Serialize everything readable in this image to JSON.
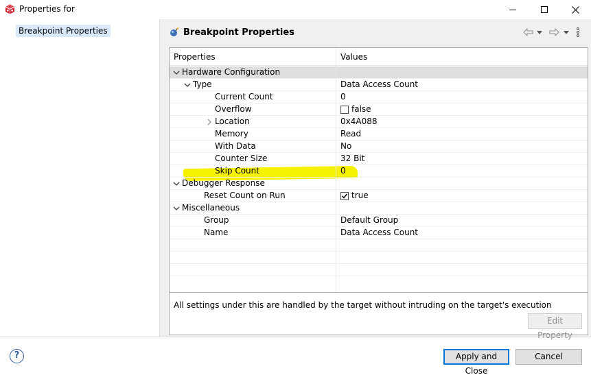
{
  "window": {
    "title": "Properties for",
    "app_icon": "cube-logo-icon",
    "controls": [
      "minimize-icon",
      "maximize-icon",
      "close-icon"
    ]
  },
  "sidebar": {
    "items": [
      {
        "label": "Breakpoint Properties",
        "selected": true
      }
    ]
  },
  "panel": {
    "title": "Breakpoint Properties",
    "title_icon": "breakpoint-properties-icon",
    "nav_icons": [
      "back-arrow-icon",
      "dropdown-icon",
      "forward-arrow-icon",
      "dropdown-icon",
      "view-menu-icon"
    ]
  },
  "table": {
    "columns": [
      "Properties",
      "Values"
    ],
    "rows": [
      {
        "label": "Hardware Configuration",
        "value": "",
        "indent": 0,
        "chevron": "down",
        "selected": true
      },
      {
        "label": "Type",
        "value": "Data Access Count",
        "indent": 1,
        "chevron": "down"
      },
      {
        "label": "Current Count",
        "value": "0",
        "indent": 3
      },
      {
        "label": "Overflow",
        "value": "false",
        "indent": 3,
        "checkbox": false
      },
      {
        "label": "Location",
        "value": "0x4A088",
        "indent": 3,
        "chevron": "right"
      },
      {
        "label": "Memory",
        "value": "Read",
        "indent": 3
      },
      {
        "label": "With Data",
        "value": "No",
        "indent": 3
      },
      {
        "label": "Counter Size",
        "value": "32 Bit",
        "indent": 3
      },
      {
        "label": "Skip Count",
        "value": "0",
        "indent": 3
      },
      {
        "label": "Debugger Response",
        "value": "",
        "indent": 0,
        "chevron": "down"
      },
      {
        "label": "Reset Count on Run",
        "value": "true",
        "indent": 2,
        "checkbox": true,
        "highlighted": true
      },
      {
        "label": "Miscellaneous",
        "value": "",
        "indent": 0,
        "chevron": "down"
      },
      {
        "label": "Group",
        "value": "Default Group",
        "indent": 2
      },
      {
        "label": "Name",
        "value": "Data Access Count",
        "indent": 2
      }
    ],
    "empty_rows": 3
  },
  "description": "All settings under this are handled by the target without intruding on the target's execution",
  "buttons": {
    "edit_property": "Edit Property",
    "apply_close": "Apply and Close",
    "cancel": "Cancel",
    "help": "?"
  },
  "colors": {
    "highlight": "#f5f100",
    "selection": "#d9e8fb",
    "default_button_border": "#0078d7"
  }
}
